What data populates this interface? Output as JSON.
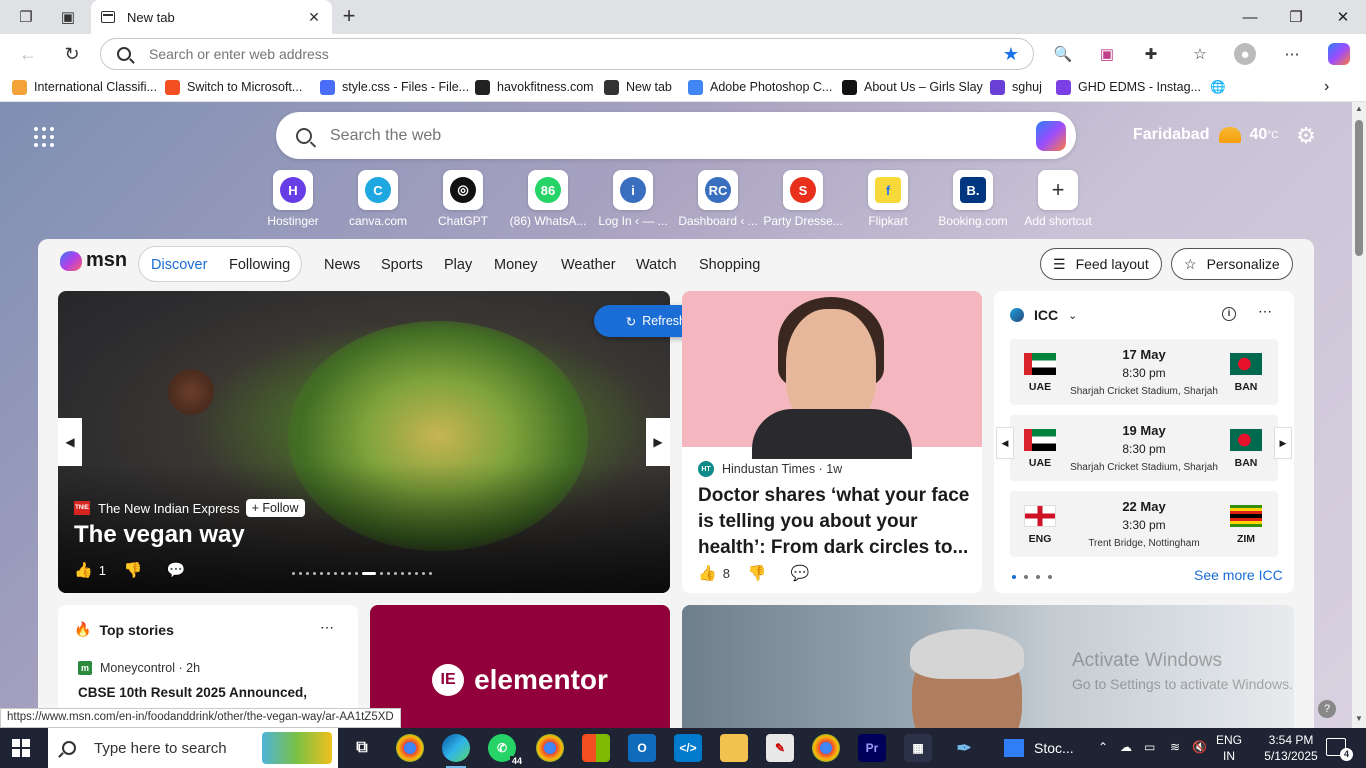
{
  "browser": {
    "tab": {
      "title": "New tab"
    },
    "address": {
      "placeholder": "Search or enter web address"
    },
    "bookmarks": [
      {
        "label": "International Classifi...",
        "color": "#f3a33a"
      },
      {
        "label": "Switch to Microsoft...",
        "color": "#f25022"
      },
      {
        "label": "style.css - Files - File...",
        "color": "#4a6cf7"
      },
      {
        "label": "havokfitness.com",
        "color": "#222222"
      },
      {
        "label": "New tab",
        "color": "#333333"
      },
      {
        "label": "Adobe Photoshop C...",
        "color": "#4285f4"
      },
      {
        "label": "About Us – Girls Slay",
        "color": "#111111"
      },
      {
        "label": "sghuj",
        "color": "#6a3fd8"
      },
      {
        "label": "GHD EDMS - Instag...",
        "color": "#7b3fe4"
      }
    ]
  },
  "newtab": {
    "search_placeholder": "Search the web",
    "weather": {
      "city": "Faridabad",
      "temp": "40",
      "unit": "°C"
    },
    "shortcuts": [
      {
        "label": "Hostinger",
        "letter": "H",
        "color": "#673de6"
      },
      {
        "label": "canva.com",
        "letter": "C",
        "color": "#1ea7e0"
      },
      {
        "label": "ChatGPT",
        "letter": "◎",
        "color": "#111111"
      },
      {
        "label": "(86) WhatsA...",
        "letter": "86",
        "color": "#25d366"
      },
      {
        "label": "Log In ‹ — ...",
        "letter": "i",
        "color": "#3a6fbf"
      },
      {
        "label": "Dashboard ‹ ...",
        "letter": "RC",
        "color": "#3a6fbf"
      },
      {
        "label": "Party Dresse...",
        "letter": "S",
        "color": "#e8301c"
      },
      {
        "label": "Flipkart",
        "letter": "f",
        "color": "#f8d93a"
      },
      {
        "label": "Booking.com",
        "letter": "B.",
        "color": "#003580"
      },
      {
        "label": "Add shortcut",
        "letter": "+",
        "color": "#ffffff"
      }
    ]
  },
  "feed": {
    "brand": "msn",
    "tabs": [
      "Discover",
      "Following"
    ],
    "nav": [
      "News",
      "Sports",
      "Play",
      "Money",
      "Weather",
      "Watch",
      "Shopping"
    ],
    "feed_layout": "Feed layout",
    "personalize": "Personalize",
    "refresh": "Refresh stories",
    "hero": {
      "source": "The New Indian Express",
      "badge": "TNIE",
      "follow": "Follow",
      "title": "The vegan way",
      "likes": "1",
      "slide_count": 19,
      "active_slide": 10
    },
    "story2": {
      "source": "Hindustan Times",
      "badge": "HT",
      "age": "1w",
      "title": "Doctor shares ‘what your face is telling you about your health’: From dark circles to...",
      "likes": "8"
    },
    "icc": {
      "title": "ICC",
      "matches": [
        {
          "date": "17 May",
          "time": "8:30 pm",
          "venue": "Sharjah Cricket Stadium, Sharjah",
          "home": "UAE",
          "away": "BAN",
          "home_flag": "uae",
          "away_flag": "ban"
        },
        {
          "date": "19 May",
          "time": "8:30 pm",
          "venue": "Sharjah Cricket Stadium, Sharjah",
          "home": "UAE",
          "away": "BAN",
          "home_flag": "uae",
          "away_flag": "ban"
        },
        {
          "date": "22 May",
          "time": "3:30 pm",
          "venue": "Trent Bridge, Nottingham",
          "home": "ENG",
          "away": "ZIM",
          "home_flag": "eng",
          "away_flag": "zim"
        }
      ],
      "see_more": "See more ICC"
    },
    "top_stories": {
      "heading": "Top stories",
      "source": "Moneycontrol",
      "age": "2h",
      "title": "CBSE 10th Result 2025 Announced,"
    },
    "ad": {
      "brand": "elementor"
    },
    "watermark": {
      "line1": "Activate Windows",
      "line2": "Go to Settings to activate Windows."
    }
  },
  "status_url": "https://www.msn.com/en-in/foodanddrink/other/the-vegan-way/ar-AA1tZ5XD",
  "taskbar": {
    "search_placeholder": "Type here to search",
    "whatsapp_count": "44",
    "stocks_label": "Stoc...",
    "lang1": "ENG",
    "lang2": "IN",
    "time": "3:54 PM",
    "date": "5/13/2025",
    "notifications": "4"
  }
}
